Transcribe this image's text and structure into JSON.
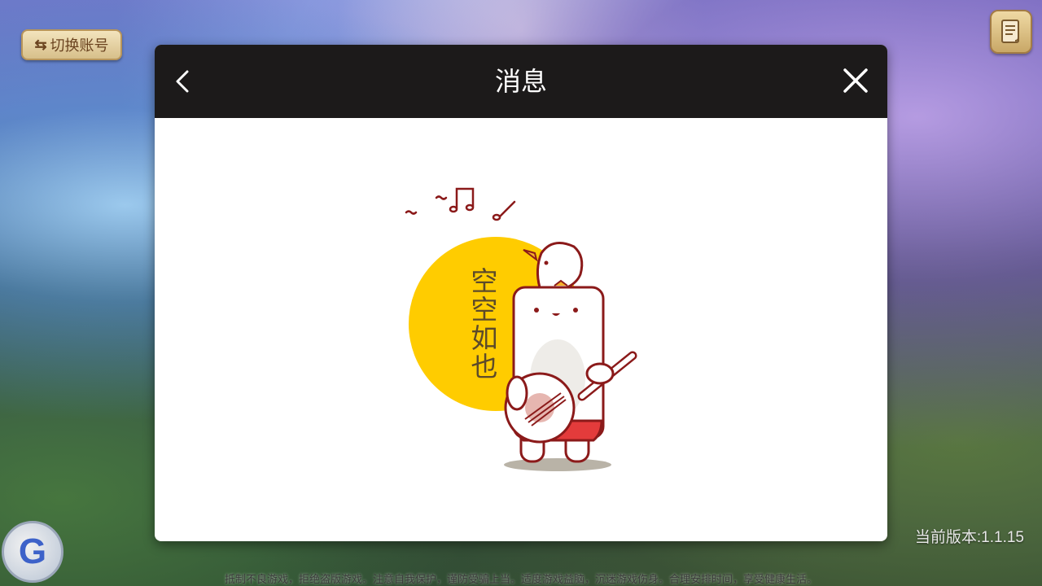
{
  "top_left": {
    "switch_account_label": "切换账号",
    "icon": "swap-arrows-icon"
  },
  "top_right": {
    "icon": "notice-scroll-icon"
  },
  "dialog": {
    "title": "消息",
    "back_icon": "chevron-left-icon",
    "close_icon": "close-icon",
    "empty_state": {
      "text": "空空如也",
      "illustration": "character-playing-banjo"
    }
  },
  "bottom_left": {
    "logo_letter": "G",
    "icon": "g-logo-icon"
  },
  "version_text": "当前版本:1.1.15",
  "health_notice": "抵制不良游戏，拒绝盗版游戏。注意自我保护，谨防受骗上当。适度游戏益脑，沉迷游戏伤身。合理安排时间，享受健康生活。",
  "colors": {
    "header_bg": "#1c1a1a",
    "dialog_bg": "#ffffff",
    "accent_yellow": "#ffcc00",
    "outline_red": "#8b1a1a"
  }
}
